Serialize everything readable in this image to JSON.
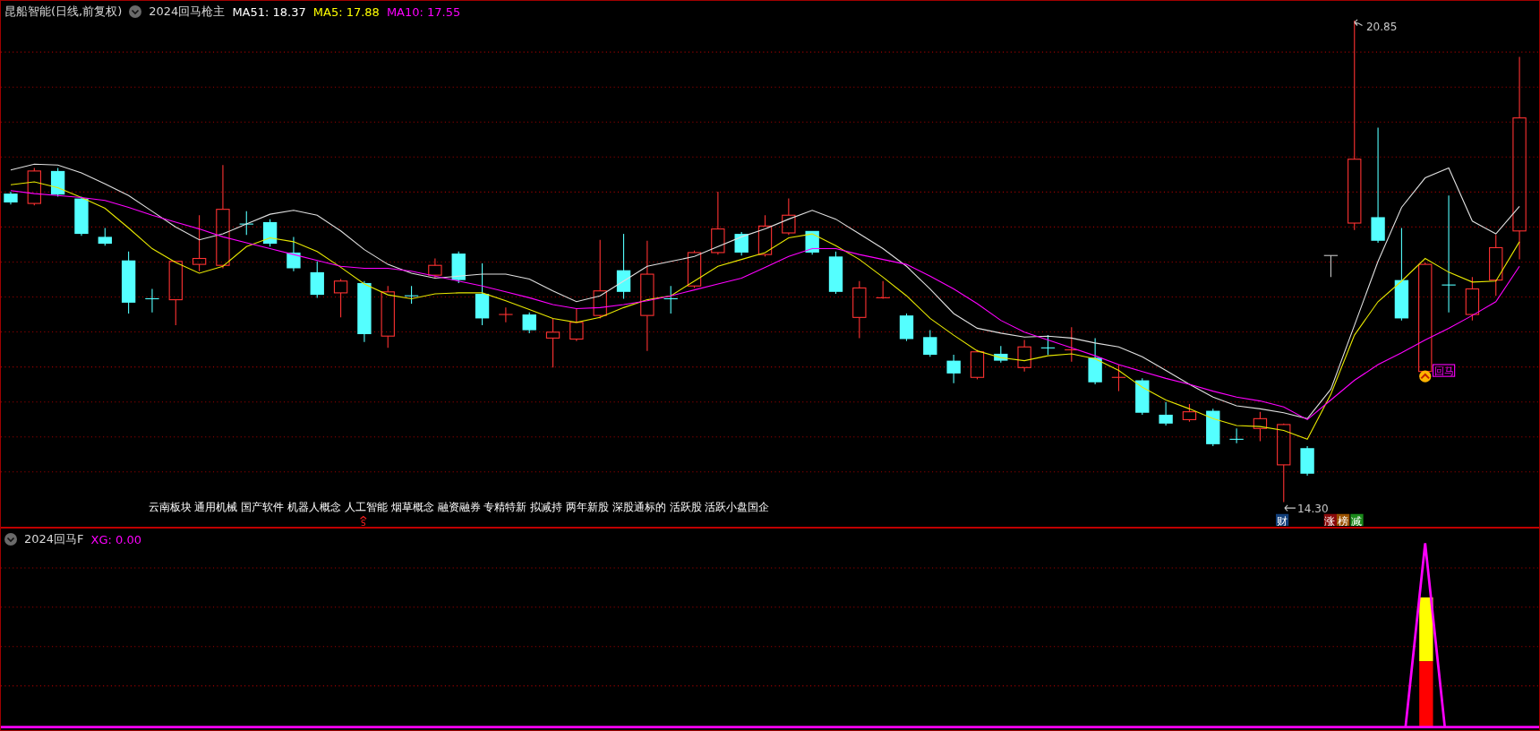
{
  "main_panel": {
    "stock_title": "昆船智能(日线,前复权)",
    "indicator_name": "2024回马枪主",
    "ma_readings": [
      {
        "label": "MA51:",
        "value": "18.37",
        "color": "#ffffff"
      },
      {
        "label": "MA5:",
        "value": "17.88",
        "color": "#ffff00"
      },
      {
        "label": "MA10:",
        "value": "17.55",
        "color": "#ff00ff"
      }
    ],
    "high_label": "20.85",
    "low_label": "14.30",
    "concept_tags": "云南板块 通用机械 国产软件 机器人概念 人工智能 烟草概念  融资融券 专精特新 拟减持 两年新股 深股通标的 活跃股 活跃小盘国企",
    "sell_marker": "S",
    "signal_label": "回马",
    "event_badges": [
      {
        "text": "财",
        "color": "#123f7a"
      },
      {
        "text": "涨",
        "color": "#8a0a0a"
      },
      {
        "text": "榜",
        "color": "#9a5200"
      },
      {
        "text": "减",
        "color": "#1a8a1a"
      }
    ]
  },
  "sub_panel": {
    "indicator_name": "2024回马F",
    "reading": "XG: 0.00"
  }
}
